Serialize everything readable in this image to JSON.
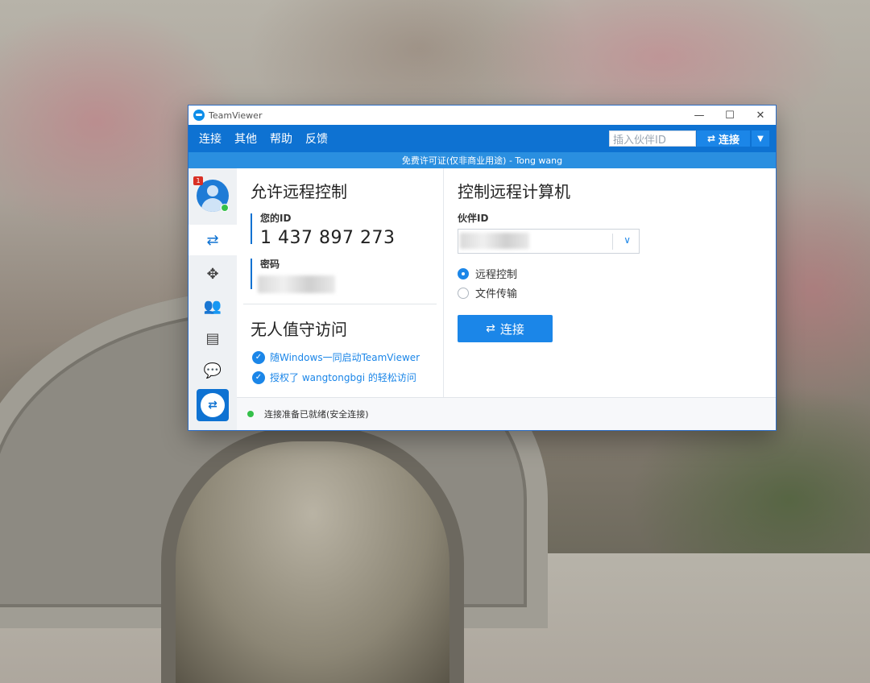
{
  "window": {
    "title": "TeamViewer",
    "controls": {
      "minimize": "—",
      "maximize": "☐",
      "close": "✕"
    }
  },
  "menu": {
    "items": [
      "连接",
      "其他",
      "帮助",
      "反馈"
    ]
  },
  "quick_connect": {
    "placeholder": "插入伙伴ID",
    "button_label": "连接",
    "dropdown_icon": "chevron-down"
  },
  "license_bar": {
    "text": "免费许可证(仅非商业用途) - Tong wang"
  },
  "sidebar": {
    "notification_count": "1",
    "items": [
      "remote-control",
      "meeting",
      "contacts",
      "computers-contacts",
      "chat"
    ],
    "logo": "teamviewer-logo"
  },
  "allow_remote": {
    "heading": "允许远程控制",
    "your_id_label": "您的ID",
    "your_id_value": "1 437 897 273",
    "password_label": "密码"
  },
  "unattended": {
    "heading": "无人值守访问",
    "options": [
      {
        "label": "随Windows一同启动TeamViewer",
        "checked": true
      },
      {
        "label": "授权了 wangtongbgi 的轻松访问",
        "checked": true
      }
    ]
  },
  "control_remote": {
    "heading": "控制远程计算机",
    "partner_id_label": "伙伴ID",
    "modes": [
      {
        "label": "远程控制",
        "selected": true
      },
      {
        "label": "文件传输",
        "selected": false
      }
    ],
    "connect_label": "连接"
  },
  "status": {
    "text": "连接准备已就绪(安全连接)",
    "state_color": "#35c04a"
  },
  "colors": {
    "brand": "#0e72d2",
    "accent": "#1b86e8"
  }
}
